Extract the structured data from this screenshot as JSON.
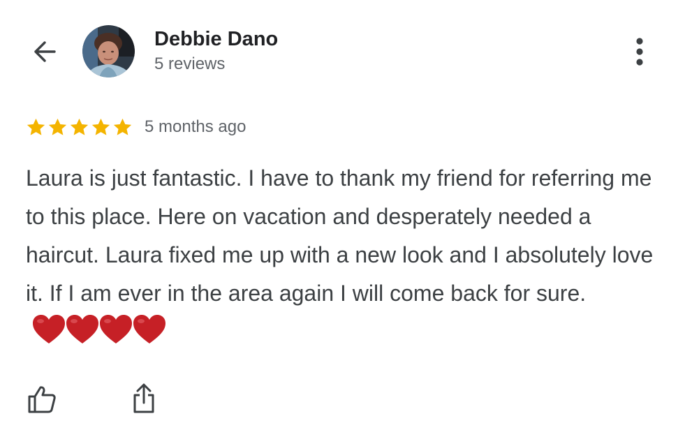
{
  "header": {
    "back_icon": "arrow-back-icon",
    "reviewer_name": "Debbie Dano",
    "review_count": "5 reviews",
    "more_icon": "more-vertical-icon"
  },
  "review": {
    "rating": 5,
    "rating_max": 5,
    "star_color": "#f4b400",
    "time_ago": "5 months ago",
    "text": "Laura is just fantastic. I have to thank my friend for referring me to this place. Here on vacation and desperately needed a haircut. Laura fixed me up with a new look and I absolutely love it. If I am ever in the area again I will come back for sure.",
    "emoji": [
      "heart",
      "heart",
      "heart",
      "heart"
    ],
    "emoji_color": "#c62026"
  },
  "actions": {
    "like_icon": "thumbs-up-icon",
    "share_icon": "share-icon"
  }
}
